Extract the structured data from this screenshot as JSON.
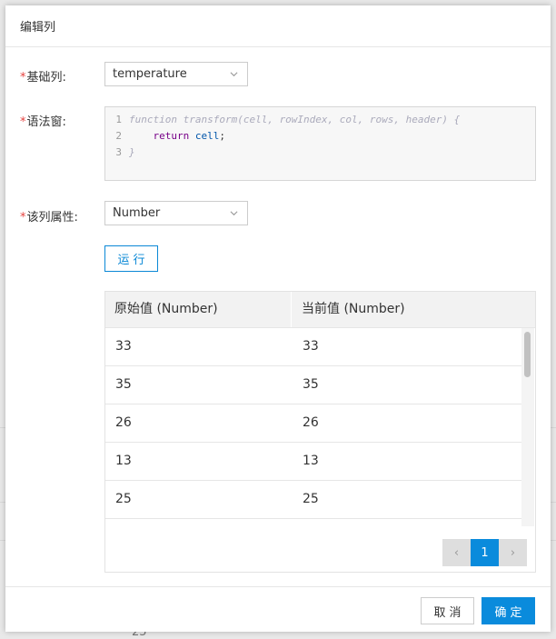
{
  "dialog": {
    "title": "编辑列"
  },
  "form": {
    "base_column": {
      "required_mark": "*",
      "label": "基础列:",
      "value": "temperature"
    },
    "syntax_window": {
      "required_mark": "*",
      "label": "语法窗:"
    },
    "column_property": {
      "required_mark": "*",
      "label": "该列属性:",
      "value": "Number"
    }
  },
  "code": {
    "lines": [
      {
        "num": "1",
        "text": "function transform(cell, rowIndex, col, rows, header) {"
      },
      {
        "num": "2",
        "keyword": "return",
        "var": "cell",
        "tail": ";"
      },
      {
        "num": "3",
        "text": "}"
      }
    ]
  },
  "run_button": {
    "label": "运行"
  },
  "table": {
    "columns": [
      "原始值 (Number)",
      "当前值 (Number)"
    ],
    "rows": [
      [
        "33",
        "33"
      ],
      [
        "35",
        "35"
      ],
      [
        "26",
        "26"
      ],
      [
        "13",
        "13"
      ],
      [
        "25",
        "25"
      ]
    ],
    "pagination": {
      "prev": "‹",
      "current": "1",
      "next": "›"
    }
  },
  "footer": {
    "cancel_label": "取消",
    "ok_label": "确定"
  },
  "background": {
    "residue_text": "25"
  },
  "colors": {
    "accent": "#0a8bdc",
    "required": "#e64340"
  }
}
